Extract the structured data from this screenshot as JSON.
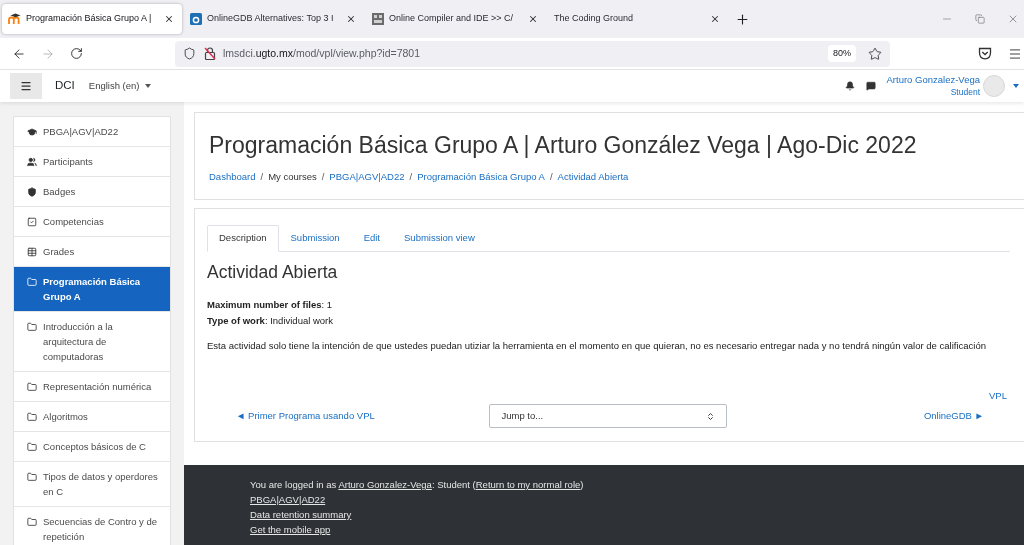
{
  "browser": {
    "tabs": [
      {
        "title": "Programación Básica Grupo A |",
        "selected": true,
        "kind": "hat"
      },
      {
        "title": "OnlineGDB Alternatives: Top 3 I",
        "selected": false,
        "kind": "square"
      },
      {
        "title": "Online Compiler and IDE >> C/",
        "selected": false,
        "kind": "grid"
      },
      {
        "title": "The Coding Ground",
        "selected": false,
        "kind": "none"
      }
    ],
    "url": "lmsdci.**ugto.mx**/mod/vpl/view.php?id=7801",
    "zoom": "80%",
    "forward_disabled": true
  },
  "navbar": {
    "site_name": "DCI",
    "language": "English (en)",
    "user_name": "Arturo Gonzalez-Vega",
    "user_role": "Student"
  },
  "sidebar": {
    "items": [
      {
        "label": "PBGA|AGV|AD22",
        "kind": "course",
        "selected": false
      },
      {
        "label": "Participants",
        "kind": "participants",
        "selected": false
      },
      {
        "label": "Badges",
        "kind": "badges",
        "selected": false
      },
      {
        "label": "Competencias",
        "kind": "competencies",
        "selected": false
      },
      {
        "label": "Grades",
        "kind": "grades",
        "selected": false
      },
      {
        "label": "Programación Básica Grupo A",
        "kind": "section",
        "selected": true
      },
      {
        "label": "Introducción a la arquitectura de computadoras",
        "kind": "section",
        "selected": false
      },
      {
        "label": "Representación numérica",
        "kind": "section",
        "selected": false
      },
      {
        "label": "Algoritmos",
        "kind": "section",
        "selected": false
      },
      {
        "label": "Conceptos básicos de C",
        "kind": "section",
        "selected": false
      },
      {
        "label": "Tipos de datos y operdores en C",
        "kind": "section",
        "selected": false
      },
      {
        "label": "Secuencias de Contro y de repetición",
        "kind": "section",
        "selected": false
      }
    ]
  },
  "header": {
    "title": "Programación Básica Grupo A | Arturo González Vega | Ago-Dic 2022",
    "separator": "/",
    "breadcrumb": [
      {
        "label": "Dashboard",
        "link": true
      },
      {
        "label": "My courses",
        "link": false
      },
      {
        "label": "PBGA|AGV|AD22",
        "link": true
      },
      {
        "label": "Programación Básica Grupo A",
        "link": true
      },
      {
        "label": "Actividad Abierta",
        "link": true
      }
    ]
  },
  "activity": {
    "tabs": [
      {
        "label": "Description",
        "selected": true
      },
      {
        "label": "Submission",
        "selected": false
      },
      {
        "label": "Edit",
        "selected": false
      },
      {
        "label": "Submission view",
        "selected": false
      }
    ],
    "heading": "Actividad Abierta",
    "fields": [
      "**Maximum number of files**: 1",
      "**Type of work**: Individual work"
    ],
    "description": "Esta actividad solo tiene la intención de que ustedes puedan utiziar la herramienta en el momento en que quieran, no es necesario entregar nada y no tendrá ningún valor de calificación",
    "side_link": "VPL",
    "previous": "◄ Primer Programa usando VPL",
    "jump_select": {
      "value": "Jump to..."
    },
    "next": "OnlineGDB ►"
  },
  "footer": {
    "login_prefix": "You are logged in as",
    "login_user": "Arturo Gonzalez-Vega",
    "login_role": ": Student (",
    "login_role_link": "Return to my normal role",
    "login_suffix": ")",
    "links": [
      "PBGA|AGV|AD22",
      "Data retention summary",
      "Get the mobile app"
    ]
  }
}
